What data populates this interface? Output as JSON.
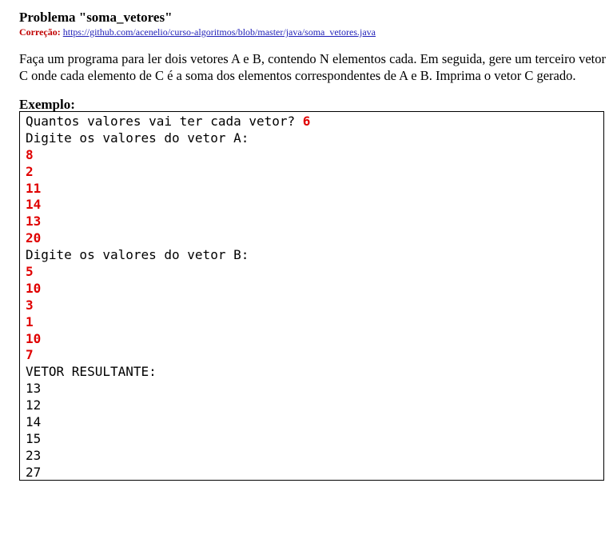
{
  "problem": {
    "title": "Problema \"soma_vetores\"",
    "correction_label": "Correção:",
    "correction_link": "https://github.com/acenelio/curso-algoritmos/blob/master/java/soma_vetores.java",
    "statement": "Faça um programa para ler dois vetores A e B, contendo N elementos cada. Em seguida, gere um terceiro vetor C onde cada elemento de C é a soma dos elementos correspondentes de A e B. Imprima o vetor C gerado.",
    "example_label": "Exemplo:"
  },
  "console": {
    "prompt_count": "Quantos valores vai ter cada vetor? ",
    "input_count": "6",
    "prompt_a": "Digite os valores do vetor A:",
    "inputs_a": [
      "8",
      "2",
      "11",
      "14",
      "13",
      "20"
    ],
    "prompt_b": "Digite os valores do vetor B:",
    "inputs_b": [
      "5",
      "10",
      "3",
      "1",
      "10",
      "7"
    ],
    "result_header": "VETOR RESULTANTE:",
    "results": [
      "13",
      "12",
      "14",
      "15",
      "23",
      "27"
    ]
  },
  "colors": {
    "input_text": "#e00000",
    "correction_label": "#c00000",
    "link": "#1f1fb8"
  }
}
